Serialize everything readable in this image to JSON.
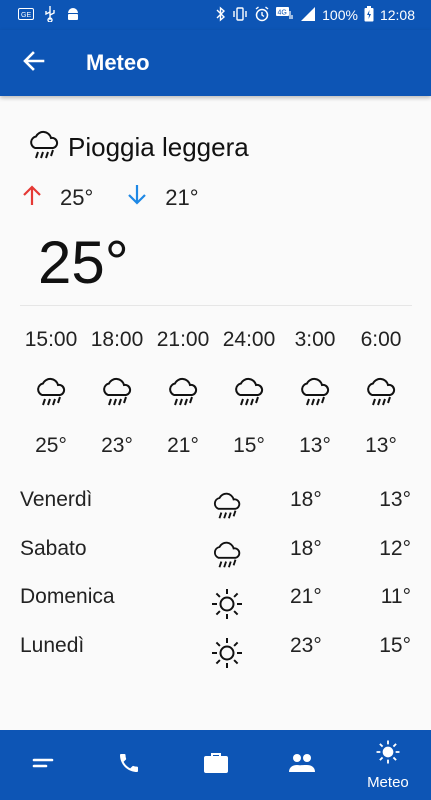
{
  "status_bar": {
    "battery_percent": "100%",
    "time": "12:08",
    "icons_left": [
      "sim-icon",
      "usb-icon",
      "android-icon"
    ],
    "icons_right": [
      "bluetooth-icon",
      "vibrate-icon",
      "alarm-icon",
      "4g-icon",
      "signal-icon",
      "battery-icon"
    ],
    "network_label": "4G"
  },
  "app_bar": {
    "title": "Meteo",
    "back_icon": "arrow-left-icon",
    "background": "#0d55b5"
  },
  "current": {
    "condition": "Pioggia leggera",
    "condition_icon": "rain-cloud-icon",
    "max": "25°",
    "min": "21°",
    "temperature": "25°",
    "up_color": "#e53935",
    "down_color": "#1e88e5"
  },
  "hourly": [
    {
      "time": "15:00",
      "icon": "rain-cloud-icon",
      "temp": "25°"
    },
    {
      "time": "18:00",
      "icon": "rain-cloud-icon",
      "temp": "23°"
    },
    {
      "time": "21:00",
      "icon": "rain-cloud-icon",
      "temp": "21°"
    },
    {
      "time": "24:00",
      "icon": "rain-cloud-icon",
      "temp": "15°"
    },
    {
      "time": "3:00",
      "icon": "rain-cloud-icon",
      "temp": "13°"
    },
    {
      "time": "6:00",
      "icon": "rain-cloud-icon",
      "temp": "13°"
    }
  ],
  "daily": [
    {
      "day": "Venerdì",
      "icon": "rain-cloud-icon",
      "max": "18°",
      "min": "13°"
    },
    {
      "day": "Sabato",
      "icon": "rain-cloud-icon",
      "max": "18°",
      "min": "12°"
    },
    {
      "day": "Domenica",
      "icon": "sun-icon",
      "max": "21°",
      "min": "11°"
    },
    {
      "day": "Lunedì",
      "icon": "sun-icon",
      "max": "23°",
      "min": "15°"
    }
  ],
  "bottom_nav": [
    {
      "icon": "menu-icon",
      "label": ""
    },
    {
      "icon": "phone-icon",
      "label": ""
    },
    {
      "icon": "briefcase-icon",
      "label": ""
    },
    {
      "icon": "people-icon",
      "label": ""
    },
    {
      "icon": "sun-icon",
      "label": "Meteo",
      "active": true
    }
  ]
}
